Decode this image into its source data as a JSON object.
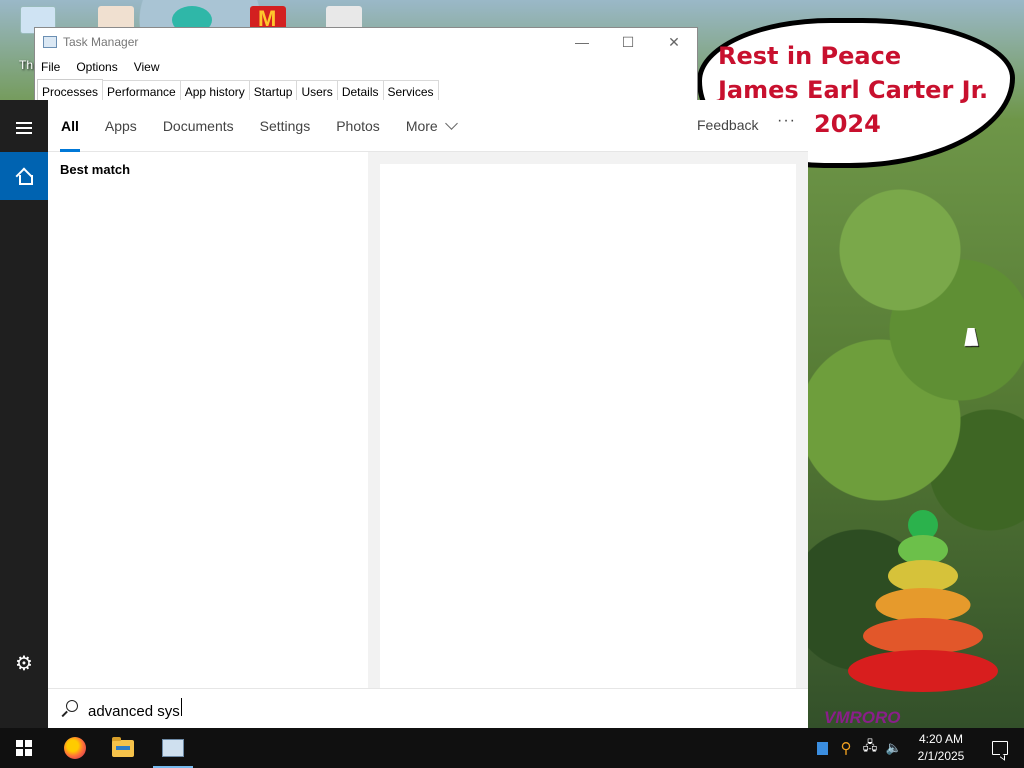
{
  "desktop": {
    "icon_label_partial": "Th",
    "bubble_lines": [
      "Rest in Peace",
      "James Earl Carter Jr.",
      "2024"
    ],
    "watermark": "VMRORO"
  },
  "task_manager": {
    "title": "Task Manager",
    "menu": [
      "File",
      "Options",
      "View"
    ],
    "tabs": [
      "Processes",
      "Performance",
      "App history",
      "Startup",
      "Users",
      "Details",
      "Services"
    ],
    "active_tab": "Processes",
    "controls": {
      "minimize": "—",
      "maximize": "☐",
      "close": "✕"
    }
  },
  "search": {
    "tabs": [
      "All",
      "Apps",
      "Documents",
      "Settings",
      "Photos",
      "More"
    ],
    "active_tab": "All",
    "feedback": "Feedback",
    "more_options": "···",
    "best_match_heading": "Best match",
    "query": "advanced sys"
  },
  "rail": {
    "icons": [
      "hamburger-icon",
      "home-icon",
      "settings-gear-icon"
    ],
    "active": "home",
    "accent": "#0063b1"
  },
  "taskbar": {
    "apps": [
      "windows-start",
      "firefox",
      "file-explorer",
      "task-manager"
    ],
    "clock_time": "4:20 AM",
    "clock_date": "2/1/2025",
    "accent": "#76b9ed"
  }
}
